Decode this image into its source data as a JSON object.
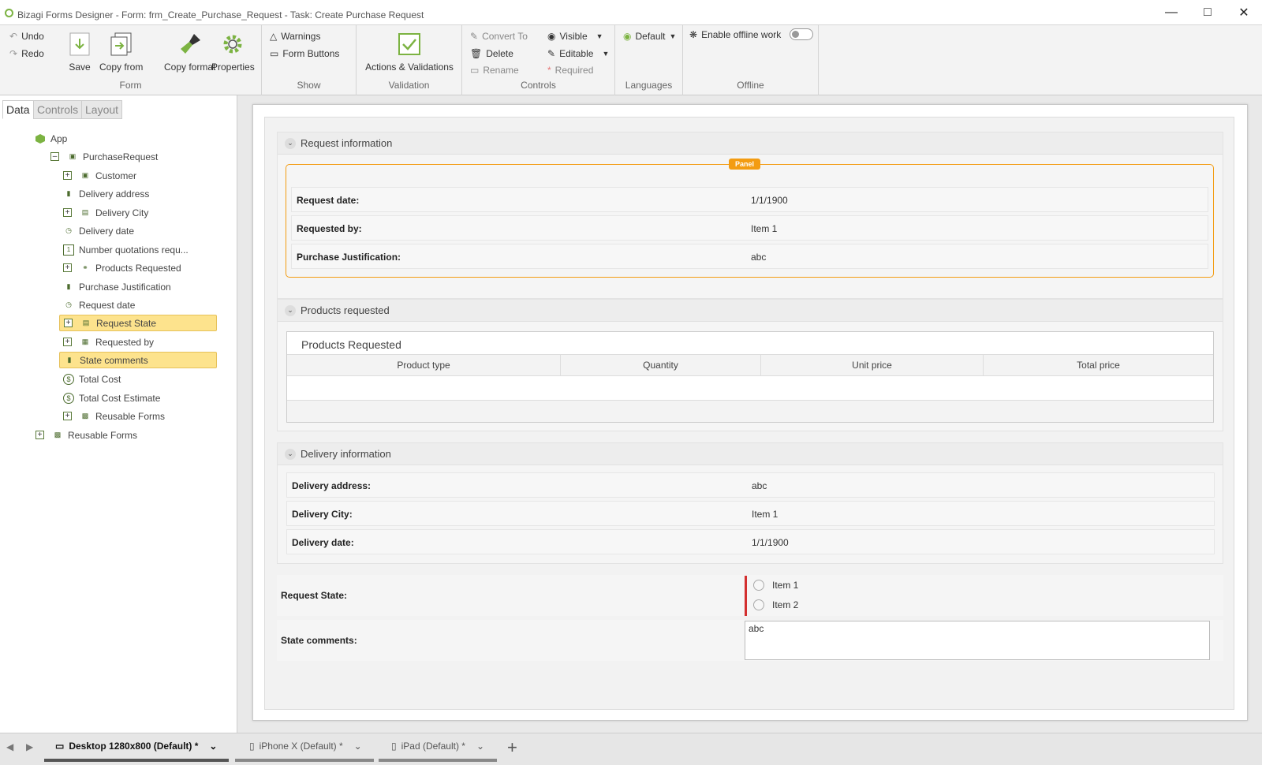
{
  "window": {
    "title": "Bizagi Forms Designer   - Form: frm_Create_Purchase_Request - Task:  Create Purchase Request"
  },
  "ribbon": {
    "undo": "Undo",
    "redo": "Redo",
    "save": "Save",
    "copy_from": "Copy from",
    "copy_format": "Copy format",
    "properties": "Properties",
    "form_group": "Form",
    "warnings": "Warnings",
    "form_buttons": "Form Buttons",
    "show_group": "Show",
    "actions_validations": "Actions & Validations",
    "validation_group": "Validation",
    "convert_to": "Convert To",
    "delete": "Delete",
    "rename": "Rename",
    "visible": "Visible",
    "editable": "Editable",
    "required": "Required",
    "controls_group": "Controls",
    "default_lang": "Default",
    "languages_group": "Languages",
    "enable_offline": "Enable offline work",
    "offline_group": "Offline"
  },
  "left_tabs": [
    "Data",
    "Controls",
    "Layout"
  ],
  "tree": {
    "app": "App",
    "purchase_request": "PurchaseRequest",
    "items": [
      "Customer",
      "Delivery address",
      "Delivery City",
      "Delivery date",
      "Number quotations requ...",
      "Products Requested",
      "Purchase Justification",
      "Request date",
      "Request State",
      "Requested by",
      "State comments",
      "Total Cost",
      "Total Cost Estimate",
      "Reusable Forms"
    ],
    "reusable_forms_root": "Reusable Forms"
  },
  "form": {
    "request_info": {
      "title": "Request information",
      "badge": "Panel",
      "rows": [
        {
          "label": "Request date:",
          "value": "1/1/1900"
        },
        {
          "label": "Requested by:",
          "value": "Item 1"
        },
        {
          "label": "Purchase Justification:",
          "value": "abc"
        }
      ]
    },
    "products": {
      "title": "Products requested",
      "grid_title": "Products Requested",
      "columns": [
        "Product type",
        "Quantity",
        "Unit price",
        "Total price"
      ]
    },
    "delivery": {
      "title": "Delivery information",
      "rows": [
        {
          "label": "Delivery address:",
          "value": "abc"
        },
        {
          "label": "Delivery City:",
          "value": "Item 1"
        },
        {
          "label": "Delivery date:",
          "value": "1/1/1900"
        }
      ]
    },
    "request_state": {
      "label": "Request State:",
      "options": [
        "Item 1",
        "Item 2"
      ]
    },
    "state_comments": {
      "label": "State comments:",
      "value": "abc"
    }
  },
  "bottom_tabs": [
    "Desktop 1280x800 (Default) *",
    "iPhone X (Default) *",
    "iPad (Default) *"
  ],
  "colors": {
    "accent_green": "#7cb342",
    "panel_orange": "#f39c12",
    "selection_yellow": "#fde38d",
    "required_red": "#d32f2f"
  }
}
